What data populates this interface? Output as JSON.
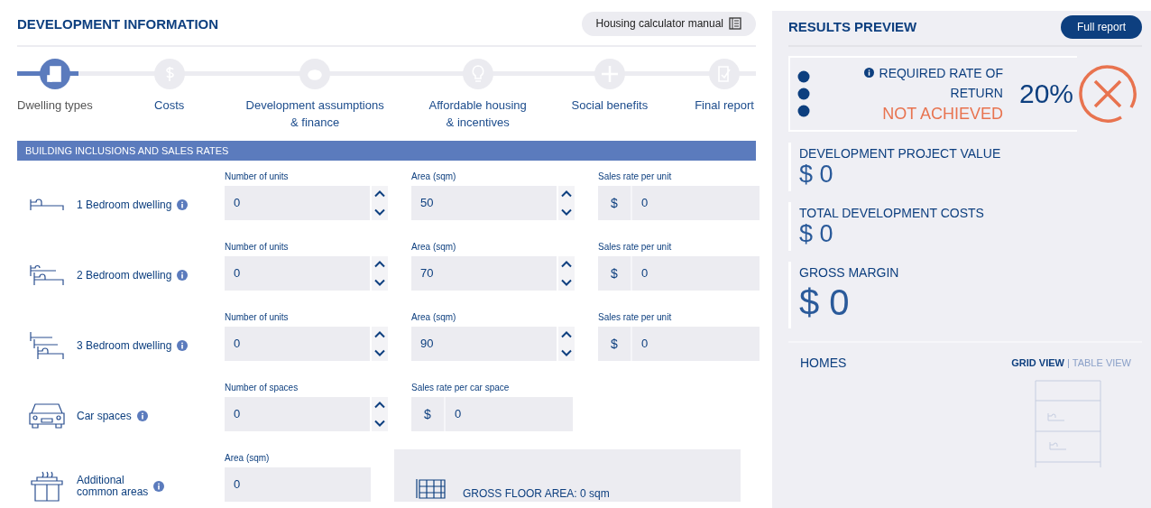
{
  "development": {
    "title": "DEVELOPMENT INFORMATION",
    "manual_button": "Housing calculator manual"
  },
  "steps": [
    {
      "label": "Dwelling types",
      "kind": "building",
      "selected": true
    },
    {
      "label": "Costs",
      "kind": "dollar",
      "selected": false
    },
    {
      "label": "Development assumptions\n& finance",
      "kind": "piggy",
      "selected": false
    },
    {
      "label": "Affordable housing\n& incentives",
      "kind": "bulb",
      "selected": false
    },
    {
      "label": "Social benefits",
      "kind": "plus",
      "selected": false
    },
    {
      "label": "Final report",
      "kind": "check",
      "selected": false
    }
  ],
  "section_title": "BUILDING INCLUSIONS AND SALES RATES",
  "rows": [
    {
      "label": "1 Bedroom dwelling",
      "kind": "bed1",
      "fields": [
        {
          "label": "Number of units",
          "value": "0",
          "kind": "stepper"
        },
        {
          "label": "Area (sqm)",
          "value": "50",
          "kind": "stepper"
        },
        {
          "label": "Sales rate per unit",
          "prefix": "$",
          "value": "0",
          "kind": "currency"
        }
      ]
    },
    {
      "label": "2 Bedroom dwelling",
      "kind": "bed2",
      "fields": [
        {
          "label": "Number of units",
          "value": "0",
          "kind": "stepper"
        },
        {
          "label": "Area (sqm)",
          "value": "70",
          "kind": "stepper"
        },
        {
          "label": "Sales rate per unit",
          "prefix": "$",
          "value": "0",
          "kind": "currency"
        }
      ]
    },
    {
      "label": "3 Bedroom dwelling",
      "kind": "bed3",
      "fields": [
        {
          "label": "Number of units",
          "value": "0",
          "kind": "stepper"
        },
        {
          "label": "Area (sqm)",
          "value": "90",
          "kind": "stepper"
        },
        {
          "label": "Sales rate per unit",
          "prefix": "$",
          "value": "0",
          "kind": "currency"
        }
      ]
    },
    {
      "label": "Car spaces",
      "kind": "car",
      "fields": [
        {
          "label": "Number of spaces",
          "value": "0",
          "kind": "stepper"
        },
        {
          "label": "Sales rate per car space",
          "prefix": "$",
          "value": "0",
          "kind": "currency"
        }
      ]
    },
    {
      "label": "Additional\ncommon areas",
      "kind": "bbq",
      "fields": [
        {
          "label": "Area (sqm)",
          "value": "0",
          "kind": "plain"
        }
      ]
    }
  ],
  "gross_floor_area": "GROSS FLOOR AREA: 0 sqm",
  "results": {
    "title": "RESULTS PREVIEW",
    "button": "Full report",
    "rate": {
      "label": "REQUIRED RATE OF\nRETURN",
      "status": "NOT ACHIEVED",
      "achieved": false,
      "value": "20%"
    },
    "metrics": [
      {
        "label": "DEVELOPMENT PROJECT VALUE",
        "value": "$ 0",
        "kind": "normal"
      },
      {
        "label": "TOTAL DEVELOPMENT COSTS",
        "value": "$ 0",
        "kind": "normal"
      },
      {
        "label": "GROSS MARGIN",
        "value": "$ 0",
        "kind": "large"
      }
    ],
    "homes": {
      "title": "HOMES",
      "separator": "|",
      "views": [
        {
          "label": "GRID VIEW",
          "selected": true
        },
        {
          "label": "TABLE VIEW",
          "selected": false
        }
      ]
    }
  }
}
